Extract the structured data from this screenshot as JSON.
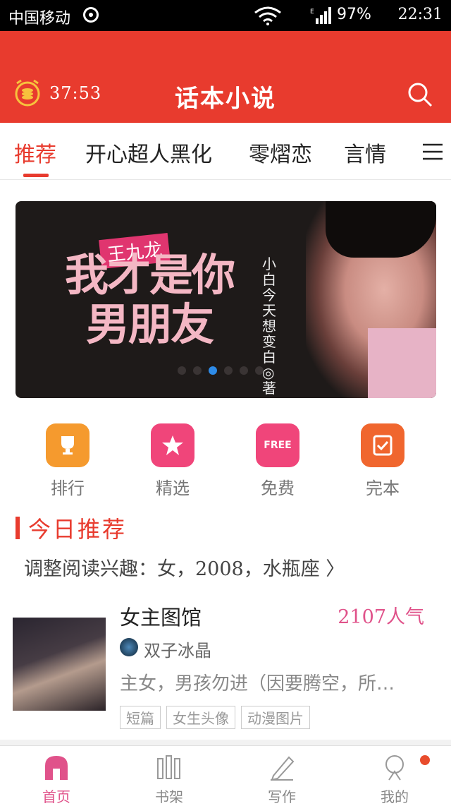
{
  "status_bar": {
    "carrier": "中国移动",
    "network": "E",
    "battery": "97%",
    "time": "22:31"
  },
  "header": {
    "timer": "37:53",
    "title": "话本小说"
  },
  "tabs": [
    {
      "label": "推荐",
      "active": true
    },
    {
      "label": "开心超人黑化"
    },
    {
      "label": "零熠恋"
    },
    {
      "label": "言情"
    }
  ],
  "banner": {
    "tag": "王九龙",
    "title_line1": "我才是你",
    "title_line2": "男朋友",
    "author": "小白今天想变白◎著",
    "active_slide_index": 2
  },
  "quick_actions": [
    {
      "label": "排行",
      "icon": "trophy-icon",
      "color": "#f59a2e"
    },
    {
      "label": "精选",
      "icon": "star-icon",
      "color": "#f0457a"
    },
    {
      "label": "免费",
      "icon": "free-tag-icon",
      "color": "#f0457a",
      "icon_text": "FREE"
    },
    {
      "label": "完本",
      "icon": "check-note-icon",
      "color": "#f0662e"
    }
  ],
  "section": {
    "title": "今日推荐",
    "preference": "调整阅读兴趣：女，2008，水瓶座 〉"
  },
  "book": {
    "title": "女主图馆",
    "popularity": "2107人气",
    "author": "双子冰晶",
    "description": "主女，男孩勿进（因要腾空，所…",
    "tags": [
      "短篇",
      "女生头像",
      "动漫图片"
    ]
  },
  "bottom_nav": [
    {
      "label": "首页",
      "active": true
    },
    {
      "label": "书架"
    },
    {
      "label": "写作"
    },
    {
      "label": "我的"
    }
  ],
  "colors": {
    "accent": "#e83b2e",
    "pink": "#e0528a"
  }
}
